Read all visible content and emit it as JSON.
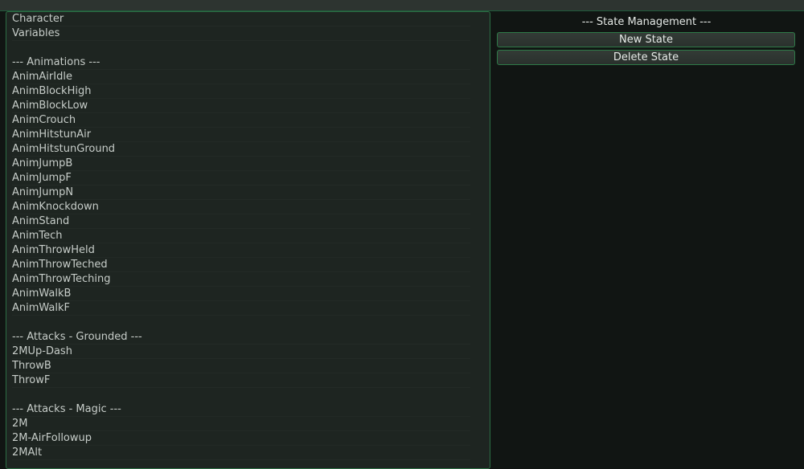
{
  "state_list": [
    "Character",
    "Variables",
    "",
    "--- Animations ---",
    "AnimAirIdle",
    "AnimBlockHigh",
    "AnimBlockLow",
    "AnimCrouch",
    "AnimHitstunAir",
    "AnimHitstunGround",
    "AnimJumpB",
    "AnimJumpF",
    "AnimJumpN",
    "AnimKnockdown",
    "AnimStand",
    "AnimTech",
    "AnimThrowHeld",
    "AnimThrowTeched",
    "AnimThrowTeching",
    "AnimWalkB",
    "AnimWalkF",
    "",
    "--- Attacks - Grounded ---",
    "2MUp-Dash",
    "ThrowB",
    "ThrowF",
    "",
    "--- Attacks - Magic ---",
    "2M",
    "2M-AirFollowup",
    "2MAlt"
  ],
  "state_management": {
    "title": "--- State Management ---",
    "new_state_label": "New State",
    "delete_state_label": "Delete State"
  }
}
